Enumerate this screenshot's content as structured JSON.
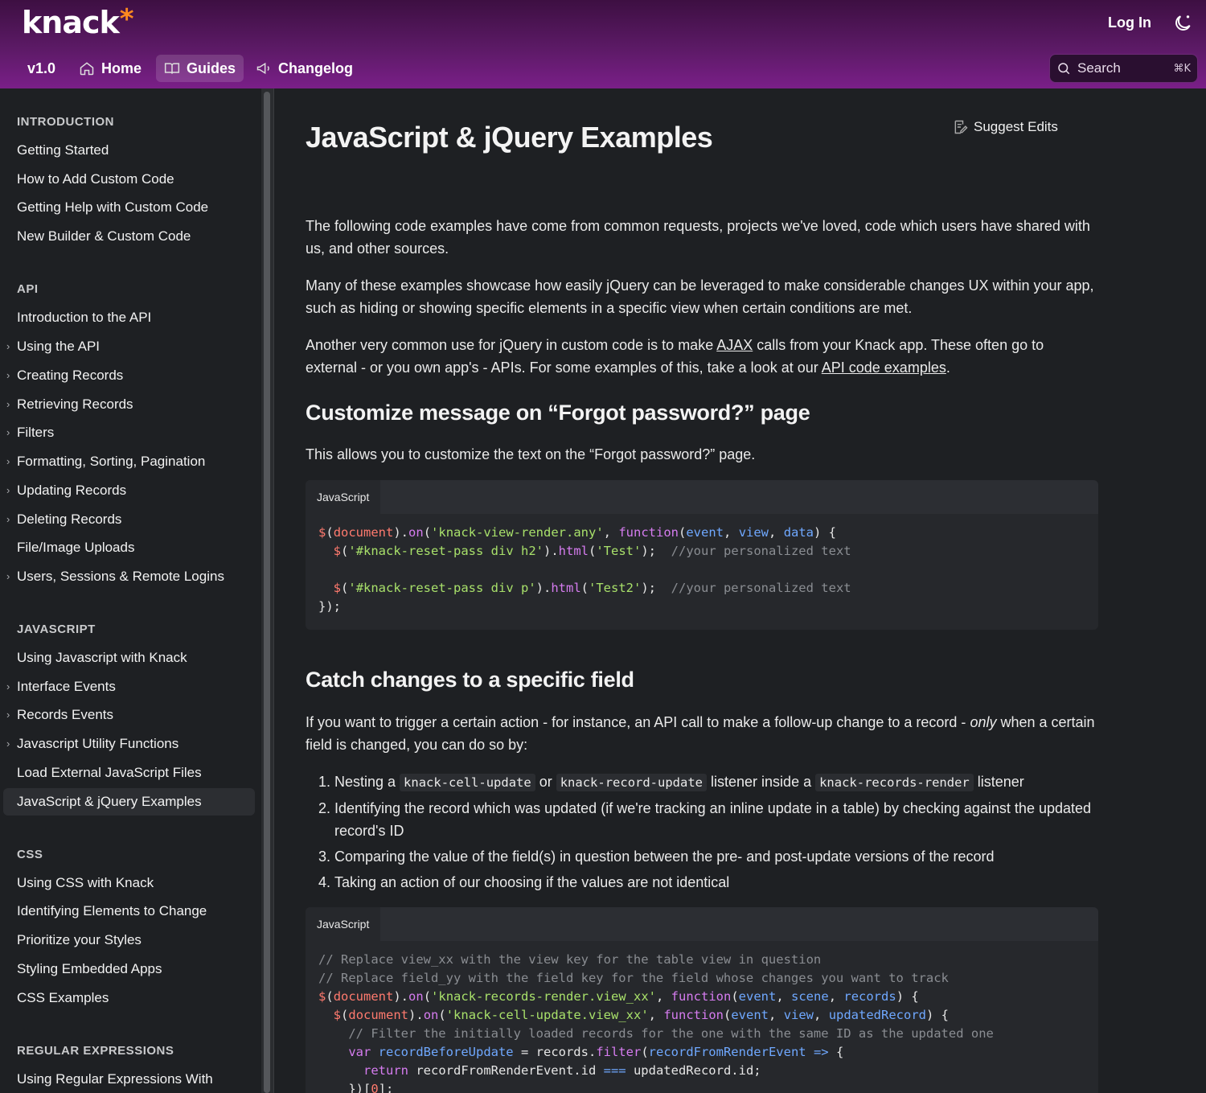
{
  "header": {
    "logo_text": "knack",
    "logo_star": "*",
    "login_label": "Log In",
    "nav": [
      {
        "label": "v1.0"
      },
      {
        "label": "Home",
        "icon": "home-icon"
      },
      {
        "label": "Guides",
        "icon": "book-icon"
      },
      {
        "label": "Changelog",
        "icon": "megaphone-icon"
      }
    ],
    "search": {
      "placeholder": "Search",
      "shortcut": "⌘K"
    }
  },
  "sidebar": {
    "sections": [
      {
        "title": "INTRODUCTION",
        "items": [
          {
            "label": "Getting Started"
          },
          {
            "label": "How to Add Custom Code"
          },
          {
            "label": "Getting Help with Custom Code"
          },
          {
            "label": "New Builder & Custom Code"
          }
        ]
      },
      {
        "title": "API",
        "items": [
          {
            "label": "Introduction to the API"
          },
          {
            "label": "Using the API",
            "expandable": true
          },
          {
            "label": "Creating Records",
            "expandable": true
          },
          {
            "label": "Retrieving Records",
            "expandable": true
          },
          {
            "label": "Filters",
            "expandable": true
          },
          {
            "label": "Formatting, Sorting, Pagination",
            "expandable": true
          },
          {
            "label": "Updating Records",
            "expandable": true
          },
          {
            "label": "Deleting Records",
            "expandable": true
          },
          {
            "label": "File/Image Uploads"
          },
          {
            "label": "Users, Sessions & Remote Logins",
            "expandable": true
          }
        ]
      },
      {
        "title": "JAVASCRIPT",
        "items": [
          {
            "label": "Using Javascript with Knack"
          },
          {
            "label": "Interface Events",
            "expandable": true
          },
          {
            "label": "Records Events",
            "expandable": true
          },
          {
            "label": "Javascript Utility Functions",
            "expandable": true
          },
          {
            "label": "Load External JavaScript Files"
          },
          {
            "label": "JavaScript & jQuery Examples",
            "active": true
          }
        ]
      },
      {
        "title": "CSS",
        "items": [
          {
            "label": "Using CSS with Knack"
          },
          {
            "label": "Identifying Elements to Change"
          },
          {
            "label": "Prioritize your Styles"
          },
          {
            "label": "Styling Embedded Apps"
          },
          {
            "label": "CSS Examples"
          }
        ]
      },
      {
        "title": "REGULAR EXPRESSIONS",
        "items": [
          {
            "label": "Using Regular Expressions With"
          }
        ]
      }
    ]
  },
  "main": {
    "title": "JavaScript & jQuery Examples",
    "suggest_edits": "Suggest Edits",
    "intro_p1": "The following code examples have come from common requests, projects we've loved, code which users have shared with us, and other sources.",
    "intro_p2": "Many of these examples showcase how easily jQuery can be leveraged to make considerable changes UX within your app, such as hiding or showing specific elements in a specific view when certain conditions are met.",
    "intro_p3_a": "Another very common use for jQuery in custom code is to make ",
    "intro_p3_link1": "AJAX",
    "intro_p3_b": " calls from your Knack app. These often go to external - or you own app's - APIs. For some examples of this, take a look at our ",
    "intro_p3_link2": "API code examples",
    "intro_p3_c": ".",
    "section1": {
      "heading": "Customize message on “Forgot password?” page",
      "desc": "This allows you to customize the text on the “Forgot password?” page.",
      "code_tab": "JavaScript"
    },
    "section2": {
      "heading": "Catch changes to a specific field",
      "desc_a": "If you want to trigger a certain action - for instance, an API call to make a follow-up change to a record - ",
      "desc_em": "only",
      "desc_b": " when a certain field is changed, you can do so by:",
      "list": {
        "item1_a": "Nesting a ",
        "item1_code1": "knack-cell-update",
        "item1_b": " or ",
        "item1_code2": "knack-record-update",
        "item1_c": " listener inside a ",
        "item1_code3": "knack-records-render",
        "item1_d": " listener",
        "item2": "Identifying the record which was updated (if we're tracking an inline update in a table) by checking against the updated record's ID",
        "item3": "Comparing the value of the field(s) in question between the pre- and post-update versions of the record",
        "item4": "Taking an action of our choosing if the values are not identical"
      },
      "code_tab": "JavaScript"
    }
  }
}
